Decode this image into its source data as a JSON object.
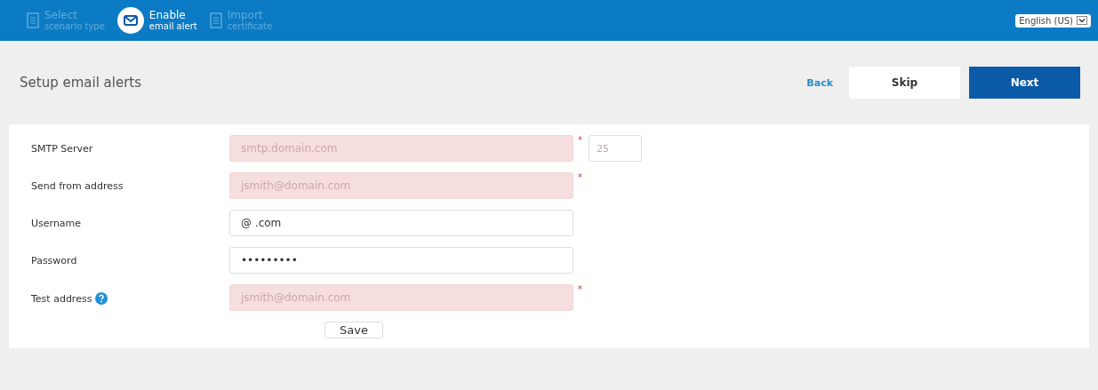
{
  "steps": [
    {
      "title": "Select",
      "subtitle": "scenario type",
      "selected": false
    },
    {
      "title": "Enable",
      "subtitle": "email alert",
      "selected": true
    },
    {
      "title": "Import",
      "subtitle": "certificate",
      "selected": false
    }
  ],
  "language": {
    "value": "English (US)"
  },
  "page_title": "Setup email alerts",
  "actions": {
    "back": "Back",
    "skip": "Skip",
    "next": "Next"
  },
  "fields": [
    {
      "label": "SMTP Server",
      "placeholder": "smtp.domain.com",
      "required": true,
      "required_mark": "*",
      "port": {
        "placeholder": "25"
      }
    },
    {
      "label": "Send from address",
      "placeholder": "jsmith@domain.com",
      "required": true,
      "required_mark": "*"
    },
    {
      "label": "Username",
      "value": "@ .com",
      "required": false
    },
    {
      "label": "Password",
      "value": "•••••••••",
      "required": false
    },
    {
      "label": "Test address",
      "placeholder": "jsmith@domain.com",
      "required": true,
      "required_mark": "*",
      "help": true
    }
  ],
  "save": "Save"
}
